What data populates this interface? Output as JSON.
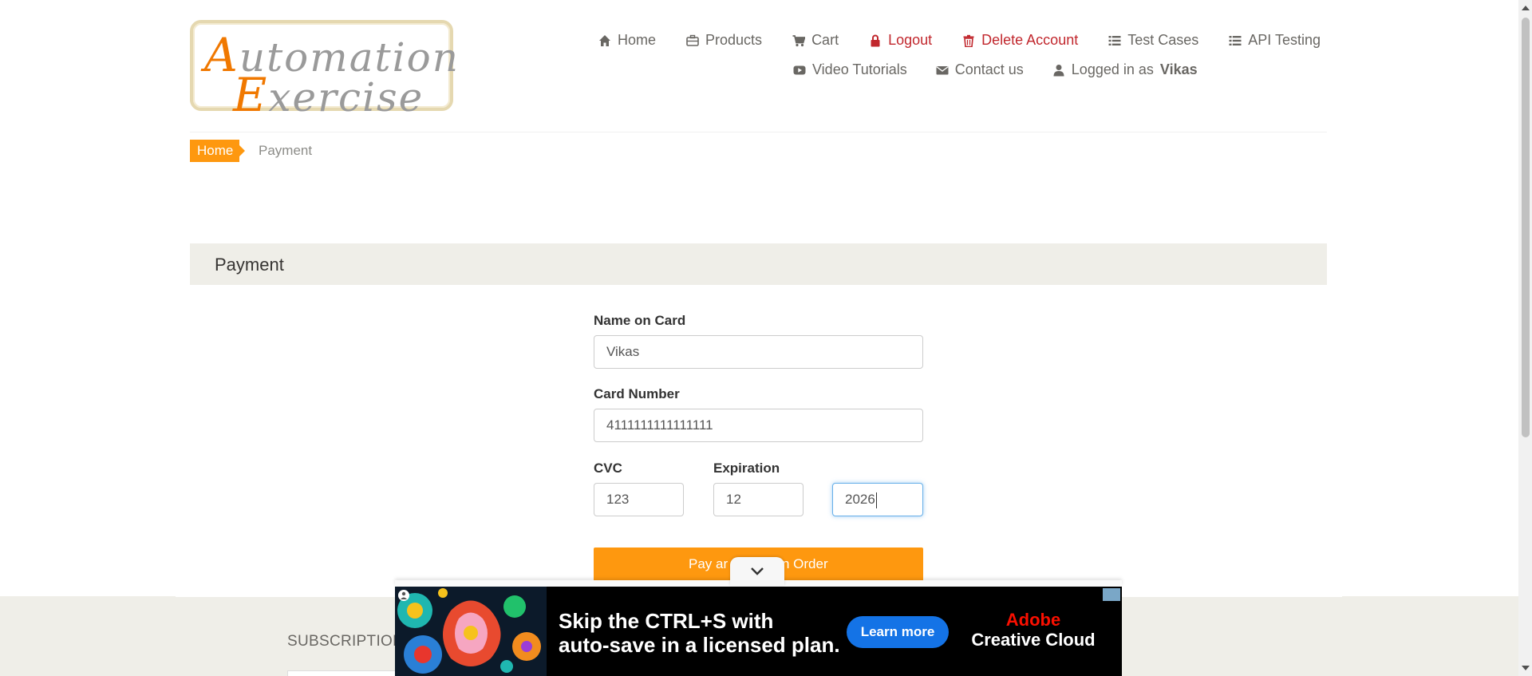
{
  "logo": {
    "line1_first": "A",
    "line1_rest": "utomation",
    "line2_first": "E",
    "line2_rest": "xercise"
  },
  "nav": {
    "home": "Home",
    "products": "Products",
    "cart": "Cart",
    "logout": "Logout",
    "delete_account": "Delete Account",
    "test_cases": "Test Cases",
    "api_testing": "API Testing",
    "video_tutorials": "Video Tutorials",
    "contact_us": "Contact us",
    "logged_in_prefix": "Logged in as",
    "logged_in_user": "Vikas"
  },
  "breadcrumb": {
    "home": "Home",
    "current": "Payment"
  },
  "payment": {
    "heading": "Payment",
    "name_label": "Name on Card",
    "name_value": "Vikas",
    "card_label": "Card Number",
    "card_value": "4111111111111111",
    "cvc_label": "CVC",
    "cvc_value": "123",
    "expiration_label": "Expiration",
    "exp_month_value": "12",
    "exp_year_value": "2026",
    "pay_button": "Pay and Confirm Order",
    "pay_button_visible_left": "Pay ar",
    "pay_button_visible_right": "n Order"
  },
  "footer": {
    "subscription": "SUBSCRIPTION"
  },
  "ad": {
    "line1": "Skip the CTRL+S with",
    "line2": "auto-save in a licensed plan.",
    "cta": "Learn more",
    "brand1": "Adobe",
    "brand2": "Creative Cloud"
  },
  "colors": {
    "accent": "#fe980f",
    "danger": "#c1272d",
    "ad_blue": "#1473e6",
    "focus": "#66afe9"
  }
}
